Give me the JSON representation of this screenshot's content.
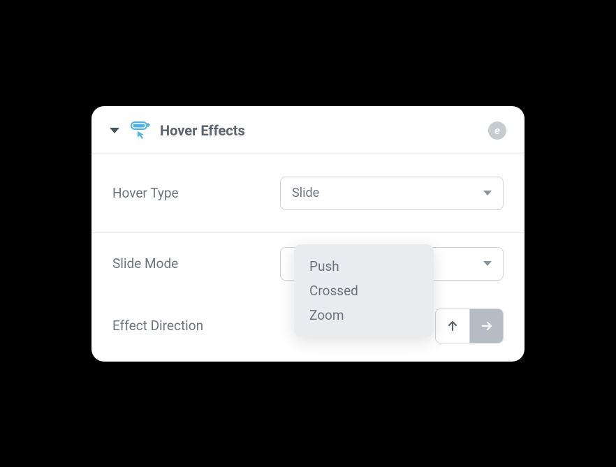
{
  "header": {
    "title": "Hover Effects",
    "badge": "e"
  },
  "rows": {
    "hoverType": {
      "label": "Hover Type",
      "value": "Slide"
    },
    "slideMode": {
      "label": "Slide Mode",
      "value": "",
      "dropdown": [
        "Push",
        "Crossed",
        "Zoom"
      ]
    },
    "effectDirection": {
      "label": "Effect Direction"
    }
  }
}
